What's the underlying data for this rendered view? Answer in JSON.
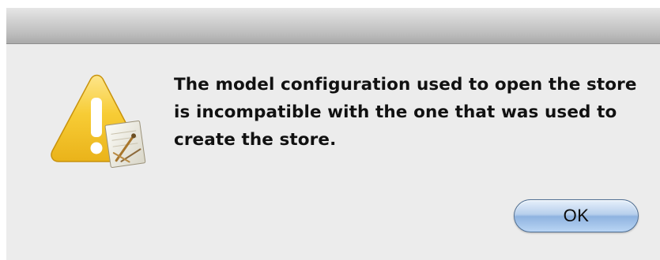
{
  "dialog": {
    "message": "The model configuration used to open the store is incompatible with the one that was used to create the store.",
    "icon": "alert-warning-icon",
    "ok_label": "OK"
  },
  "colors": {
    "window_background": "#ececec",
    "button_blue": "#9cbfe8",
    "warning_yellow": "#f6c428"
  }
}
